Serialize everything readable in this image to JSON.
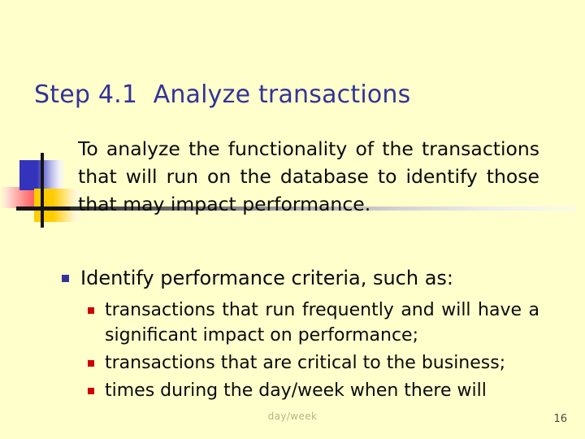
{
  "slide": {
    "background_color": "#ffffcc",
    "title": "Step 4.1  Analyze transactions",
    "title_color": "#333399",
    "paragraph": "To analyze the functionality of the transactions that will run on the database to identify those that may impact performance.",
    "level1_bullets": [
      {
        "marker": "navy-square-bullet",
        "marker_color": "#333399",
        "text": "Identify performance criteria, such as:"
      }
    ],
    "level2_bullets": [
      {
        "marker": "red-square-bullet",
        "marker_color": "#cc0000",
        "text": "transactions that run frequently and will have a significant impact on performance;"
      },
      {
        "marker": "red-square-bullet",
        "marker_color": "#cc0000",
        "text": "transactions that are critical to the business;"
      },
      {
        "marker": "red-square-bullet",
        "marker_color": "#cc0000",
        "text": "times during the day/week when there will"
      }
    ],
    "watermark": "day/week",
    "page_number": "16",
    "decoration": {
      "blue_square_color": "#3333bb",
      "yellow_square_color": "#ffcc00",
      "red_bar_color": "#ff5555",
      "cross_line_color": "#151515"
    }
  }
}
